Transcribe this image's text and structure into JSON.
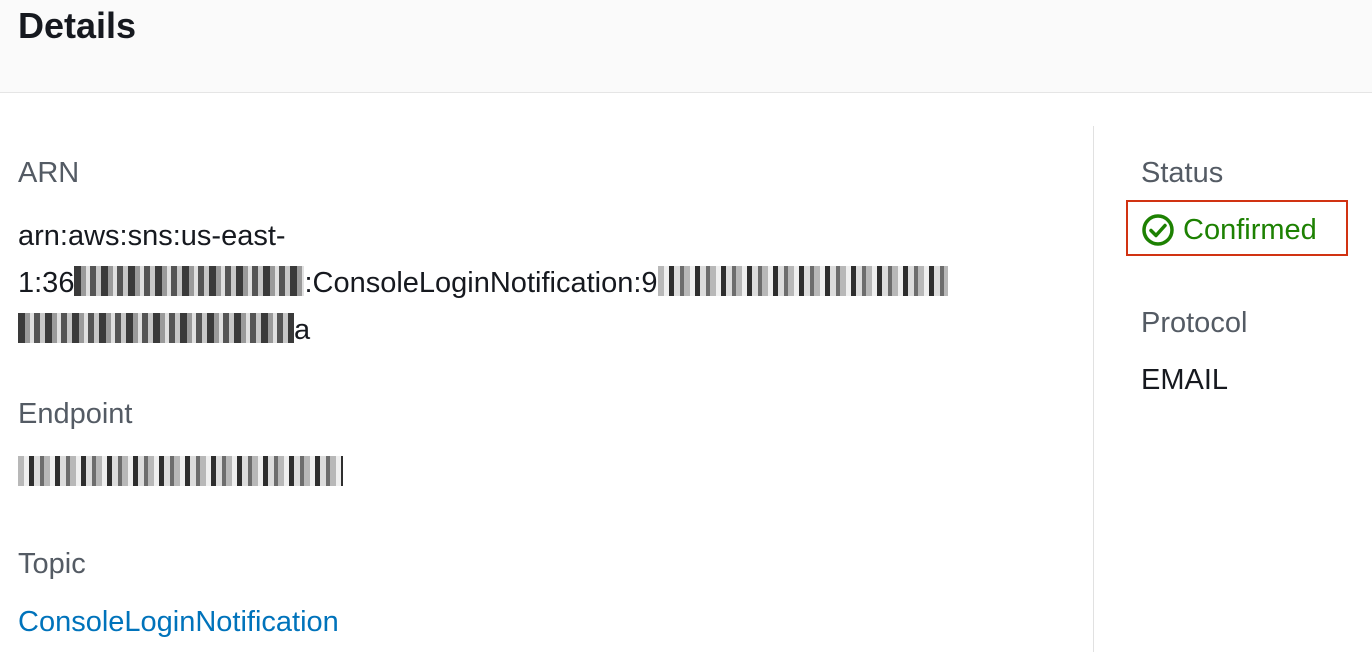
{
  "header": {
    "title": "Details"
  },
  "left": {
    "arn": {
      "label": "ARN",
      "line1": "arn:aws:sns:us-east-",
      "line2_prefix": "1:36",
      "line2_middle": ":ConsoleLoginNotification:9",
      "line3_suffix": "a"
    },
    "endpoint": {
      "label": "Endpoint"
    },
    "topic": {
      "label": "Topic",
      "link": "ConsoleLoginNotification"
    }
  },
  "right": {
    "status": {
      "label": "Status",
      "value": "Confirmed",
      "icon": "check-circle-icon",
      "color": "#1d8102"
    },
    "protocol": {
      "label": "Protocol",
      "value": "EMAIL"
    }
  },
  "colors": {
    "link": "#0073bb",
    "highlight_border": "#d13212"
  }
}
